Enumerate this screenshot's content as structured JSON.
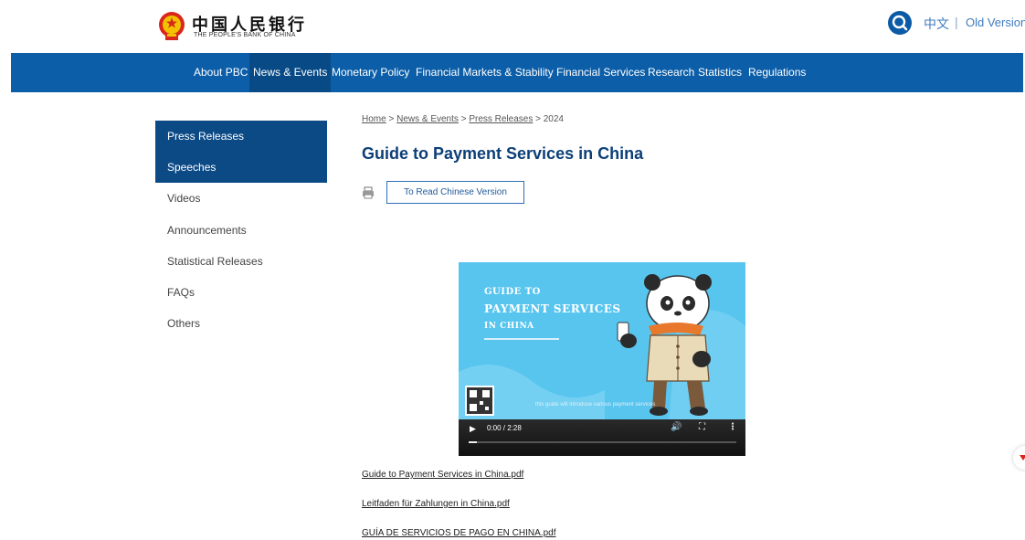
{
  "header": {
    "logo_cn": "中国人民银行",
    "logo_en": "THE PEOPLE'S BANK OF CHINA",
    "lang_cn": "中文",
    "lang_separator": "|",
    "old_version": "Old Version"
  },
  "nav": {
    "items": [
      {
        "label": "About PBC"
      },
      {
        "label": "News & Events"
      },
      {
        "label": "Monetary Policy"
      },
      {
        "label": "Financial Markets & Stability"
      },
      {
        "label": "Financial Services"
      },
      {
        "label": "Research"
      },
      {
        "label": "Statistics"
      },
      {
        "label": "Regulations"
      }
    ],
    "active_index": 1
  },
  "sidebar": {
    "items": [
      {
        "label": "Press Releases"
      },
      {
        "label": "Speeches"
      },
      {
        "label": "Videos"
      },
      {
        "label": "Announcements"
      },
      {
        "label": "Statistical Releases"
      },
      {
        "label": "FAQs"
      },
      {
        "label": "Others"
      }
    ]
  },
  "breadcrumb": {
    "home": "Home",
    "sep": ">",
    "news": "News & Events",
    "press": "Press Releases",
    "year": "2024"
  },
  "main": {
    "title": "Guide to Payment Services in China",
    "read_chinese_label": "To Read Chinese Version"
  },
  "video": {
    "line1": "GUIDE TO",
    "line2": "PAYMENT SERVICES",
    "line3": "IN CHINA",
    "caption": "this guide will introduce various payment services",
    "time": "0:00 / 2:28",
    "progress": 0.03
  },
  "files": [
    {
      "label": "Guide to Payment Services in China.pdf"
    },
    {
      "label": "Leitfaden für Zahlungen in China.pdf"
    },
    {
      "label": "GUÍA DE SERVICIOS DE PAGO EN CHINA.pdf"
    }
  ],
  "colors": {
    "nav_bg": "#0c5ea8",
    "nav_active": "#084a86",
    "sidebar_active": "#0c4a86",
    "title": "#0c3f78",
    "video_bg": "#58c5ef"
  },
  "icons": [
    "emblem-icon",
    "search-icon",
    "print-icon",
    "play-icon",
    "volume-icon",
    "fullscreen-icon",
    "more-icon"
  ]
}
